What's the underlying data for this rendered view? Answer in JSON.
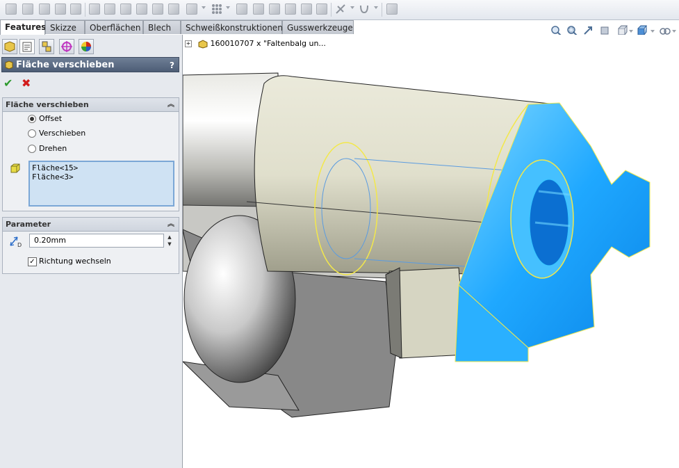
{
  "tabs": [
    {
      "label": "Features",
      "active": true
    },
    {
      "label": "Skizze"
    },
    {
      "label": "Oberflächen"
    },
    {
      "label": "Blech"
    },
    {
      "label": "Schweißkonstruktionen"
    },
    {
      "label": "Gusswerkzeuge"
    }
  ],
  "toolbar_icons": [
    "split-line-icon",
    "move-face-icon",
    "revolve-icon",
    "dome-icon",
    "shell-icon",
    "fillet-icon",
    "draft-icon",
    "wrap-icon",
    "rib-icon",
    "flex-icon",
    "deform-icon",
    "indent-icon",
    "pattern-icon",
    "mirror-icon",
    "move-copy-icon",
    "combine-icon",
    "intersect-icon",
    "delete-body-icon",
    "reference-geometry-icon",
    "curves-icon",
    "instant3d-icon"
  ],
  "view_icons": [
    "zoom-to-fit-icon",
    "zoom-to-area-icon",
    "previous-view-icon",
    "section-view-icon",
    "view-orientation-icon",
    "display-style-icon",
    "hide-show-icon"
  ],
  "panel": {
    "header_title": "Fläche verschieben",
    "help": "?",
    "ok": "✔",
    "cancel": "✖",
    "group1": {
      "title": "Fläche verschieben",
      "options": [
        {
          "label": "Offset",
          "checked": true
        },
        {
          "label": "Verschieben",
          "checked": false
        },
        {
          "label": "Drehen",
          "checked": false
        }
      ],
      "faces": [
        "Fläche<15>",
        "Fläche<3>"
      ]
    },
    "group2": {
      "title": "Parameter",
      "distance": "0.20mm",
      "checkbox_label": "Richtung wechseln",
      "checkbox_checked": true
    }
  },
  "viewport": {
    "tree_label": "160010707 x \"Faltenbalg un..."
  },
  "colors": {
    "selected_face": "#1fa8ff",
    "highlight_edge": "#f3e84a",
    "body": "#d9d8c2"
  }
}
